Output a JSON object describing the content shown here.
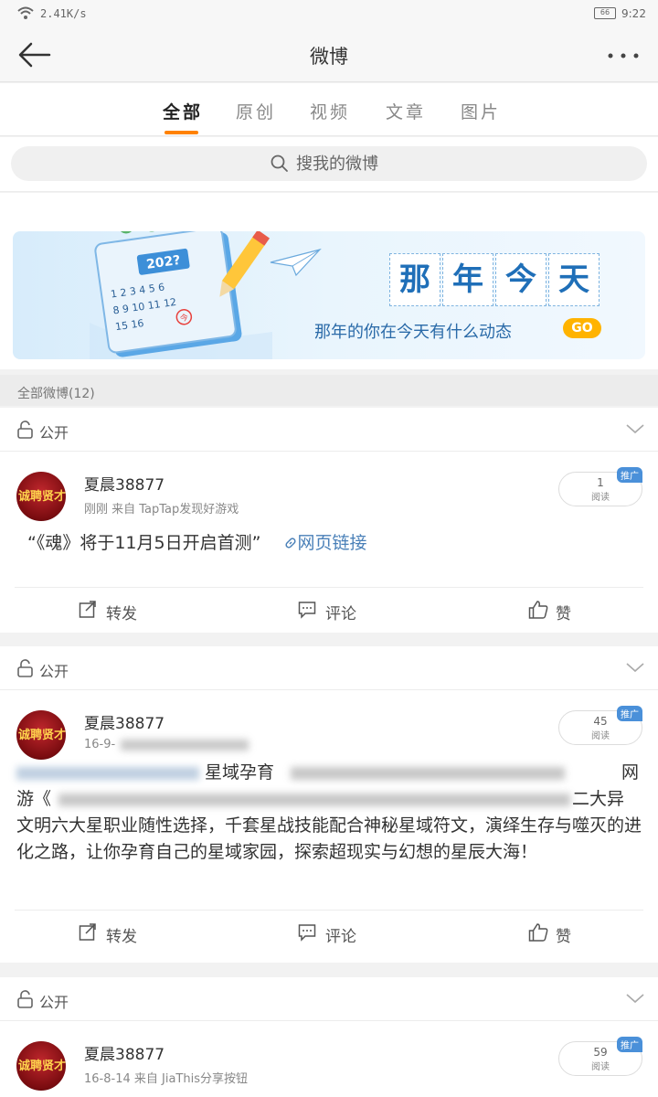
{
  "status_bar": {
    "net_speed": "2.41K/s",
    "battery": "66",
    "time": "9:22"
  },
  "nav": {
    "title": "微博"
  },
  "tabs": [
    {
      "label": "全部",
      "active": true
    },
    {
      "label": "原创"
    },
    {
      "label": "视频"
    },
    {
      "label": "文章"
    },
    {
      "label": "图片"
    }
  ],
  "search": {
    "placeholder": "搜我的微博"
  },
  "banner": {
    "calendar_year": "202?",
    "calendar_today": "今",
    "headline": [
      "那",
      "年",
      "今",
      "天"
    ],
    "subtitle": "那年的你在今天有什么动态",
    "go_label": "GO"
  },
  "section": {
    "title": "全部微博(12)"
  },
  "posts": [
    {
      "visibility": "公开",
      "author": "夏晨38877",
      "avatar_text": "诚聘贤才",
      "meta": "刚刚  来自  TapTap发现好游戏",
      "reads": "1",
      "reads_label": "阅读",
      "promo": "推广",
      "text": "“《魂》将于11月5日开启首测”",
      "link": "网页链接",
      "actions": {
        "repost": "转发",
        "comment": "评论",
        "like": "赞"
      }
    },
    {
      "visibility": "公开",
      "author": "夏晨38877",
      "avatar_text": "诚聘贤才",
      "meta": "16-9-",
      "reads": "45",
      "reads_label": "阅读",
      "promo": "推广",
      "text_line1": "星域孕育",
      "text_line2": "网",
      "text_line3": "游《",
      "text_line4": "二大异",
      "text_body": "文明六大星职业随性选择，千套星战技能配合神秘星域符文，演绎生存与噬灭的进化之路，让你孕育自己的星域家园，探索超现实与幻想的星辰大海！",
      "actions": {
        "repost": "转发",
        "comment": "评论",
        "like": "赞"
      }
    },
    {
      "visibility": "公开",
      "author": "夏晨38877",
      "avatar_text": "诚聘贤才",
      "meta": "16-8-14  来自  JiaThis分享按钮",
      "reads": "59",
      "reads_label": "阅读",
      "promo": "推广"
    }
  ]
}
